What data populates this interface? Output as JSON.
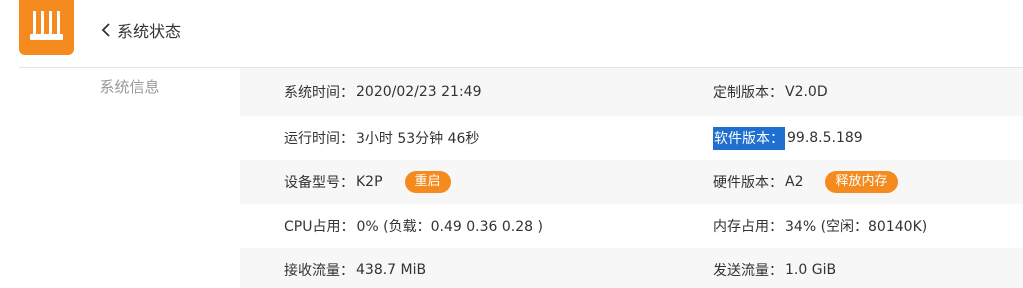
{
  "header": {
    "logo_icon": "router-icon",
    "back_icon": "chevron-left-icon",
    "title": "系统状态"
  },
  "sidebar": {
    "items": [
      {
        "label": "系统信息"
      }
    ]
  },
  "info": {
    "rows": [
      {
        "left": {
          "label": "系统时间：",
          "value": "2020/02/23 21:49"
        },
        "right": {
          "label": "定制版本：",
          "value": "V2.0D"
        }
      },
      {
        "left": {
          "label": "运行时间：",
          "value": "3小时 53分钟 46秒"
        },
        "right": {
          "label": "软件版本：",
          "value": "99.8.5.189",
          "selected": true
        }
      },
      {
        "left": {
          "label": "设备型号：",
          "value": "K2P",
          "button": "重启"
        },
        "right": {
          "label": "硬件版本：",
          "value": "A2",
          "button": "释放内存"
        }
      },
      {
        "left": {
          "label": "CPU占用：",
          "value": "0% (负载：0.49 0.36 0.28 )"
        },
        "right": {
          "label": "内存占用：",
          "value": "34% (空闲：80140K)"
        }
      },
      {
        "left": {
          "label": "接收流量：",
          "value": "438.7 MiB"
        },
        "right": {
          "label": "发送流量：",
          "value": "1.0 GiB"
        }
      }
    ]
  },
  "colors": {
    "accent": "#f58a1f",
    "selection": "#1e6fd0",
    "row_shade": "#f7f7f7",
    "muted_text": "#999999"
  }
}
